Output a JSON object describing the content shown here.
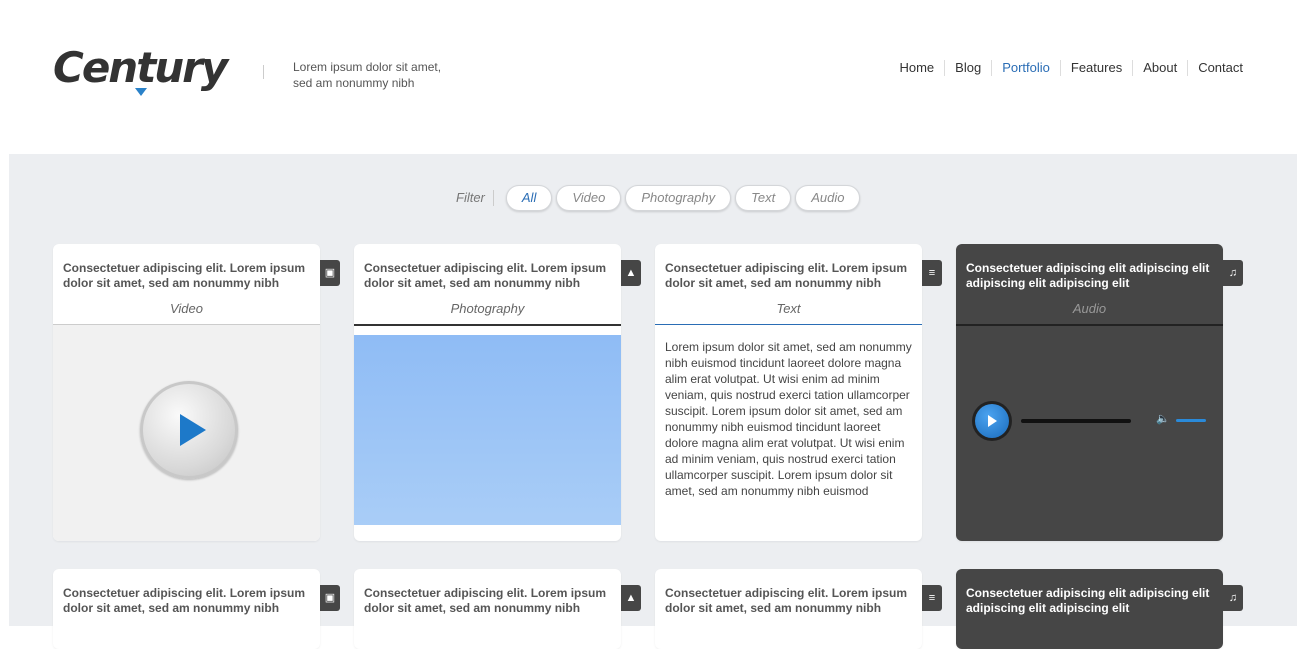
{
  "brand": {
    "logo_text": "Century",
    "tagline_line1": "Lorem ipsum dolor sit amet,",
    "tagline_line2": "sed am nonummy nibh"
  },
  "nav": {
    "items": [
      "Home",
      "Blog",
      "Portfolio",
      "Features",
      "About",
      "Contact"
    ],
    "active": "Portfolio"
  },
  "filter": {
    "label": "Filter",
    "options": [
      "All",
      "Video",
      "Photography",
      "Text",
      "Audio"
    ],
    "active": "All"
  },
  "cards": [
    {
      "title": "Consectetuer adipiscing elit. Lorem ipsum dolor sit amet, sed am nonummy nibh",
      "category": "Video",
      "icon": "film-icon"
    },
    {
      "title": "Consectetuer adipiscing elit. Lorem ipsum dolor sit amet, sed am nonummy nibh",
      "category": "Photography",
      "icon": "image-icon"
    },
    {
      "title": "Consectetuer adipiscing elit. Lorem ipsum dolor sit amet, sed am nonummy nibh",
      "category": "Text",
      "icon": "text-lines-icon",
      "body": "Lorem ipsum dolor sit amet, sed am nonummy nibh euismod tincidunt laoreet dolore magna alim erat volutpat. Ut wisi enim ad minim veniam, quis nostrud exerci tation ullamcorper suscipit. Lorem ipsum dolor sit amet, sed am nonummy nibh euismod tincidunt laoreet dolore magna alim erat volutpat. Ut wisi enim ad minim veniam, quis nostrud exerci tation ullamcorper suscipit. Lorem ipsum dolor sit amet, sed am nonummy nibh euismod"
    },
    {
      "title": "Consectetuer adipiscing elit adipiscing elit adipiscing elit adipiscing elit",
      "category": "Audio",
      "icon": "music-note-icon"
    }
  ],
  "cards_row2": [
    {
      "title": "Consectetuer adipiscing elit. Lorem ipsum dolor sit amet, sed am nonummy nibh",
      "icon": "film-icon"
    },
    {
      "title": "Consectetuer adipiscing elit. Lorem ipsum dolor sit amet, sed am nonummy nibh",
      "icon": "image-icon"
    },
    {
      "title": "Consectetuer adipiscing elit. Lorem ipsum dolor sit amet, sed am nonummy nibh",
      "icon": "text-lines-icon"
    },
    {
      "title": "Consectetuer adipiscing elit adipiscing elit adipiscing elit adipiscing elit",
      "icon": "music-note-icon"
    }
  ],
  "colors": {
    "accent": "#2a6db5",
    "dark_card": "#464646",
    "page_bg": "#eceef1"
  }
}
